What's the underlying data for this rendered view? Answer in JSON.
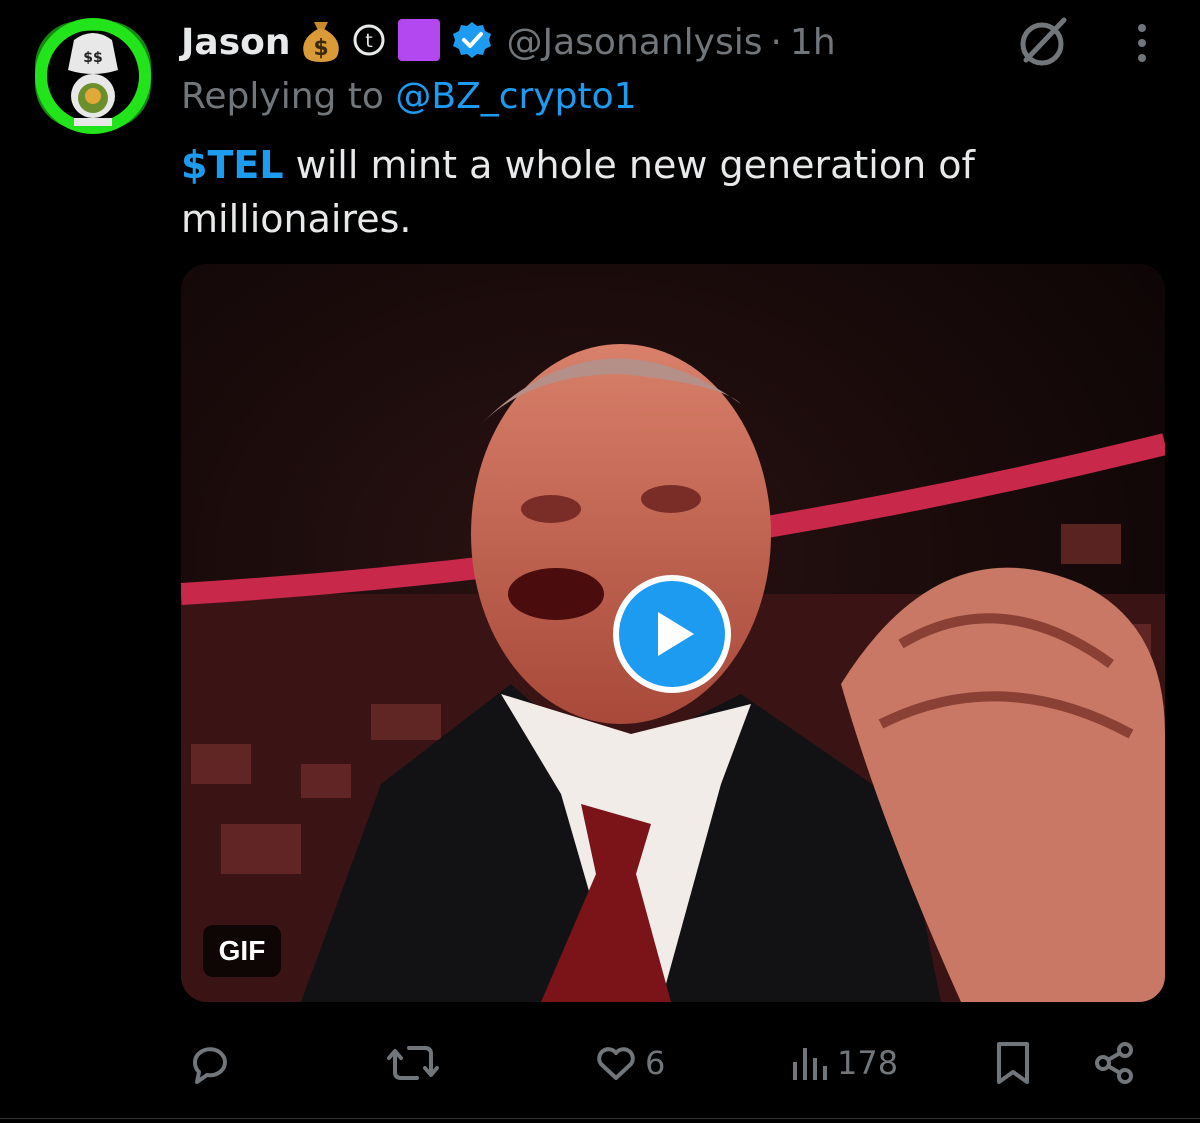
{
  "tweet": {
    "author_name": "Jason",
    "handle": "@Jasonanlysis",
    "separator": "·",
    "time": "1h",
    "reply_prefix": "Replying to ",
    "reply_to": "@BZ_crypto1",
    "cashtag": "$TEL",
    "text": " will mint a whole new generation of millionaires.",
    "name_emojis": [
      "money-bag-icon",
      "circled-t-icon",
      "purple-square-icon"
    ],
    "verified": true
  },
  "media": {
    "type": "gif",
    "badge": "GIF"
  },
  "actions": {
    "reply_count": "",
    "repost_count": "",
    "like_count": "6",
    "views_count": "178"
  },
  "colors": {
    "accent": "#1d9bf0",
    "muted": "#71767b",
    "text": "#e7e9ea",
    "background": "#000000",
    "avatar_ring": "#22e51a"
  }
}
